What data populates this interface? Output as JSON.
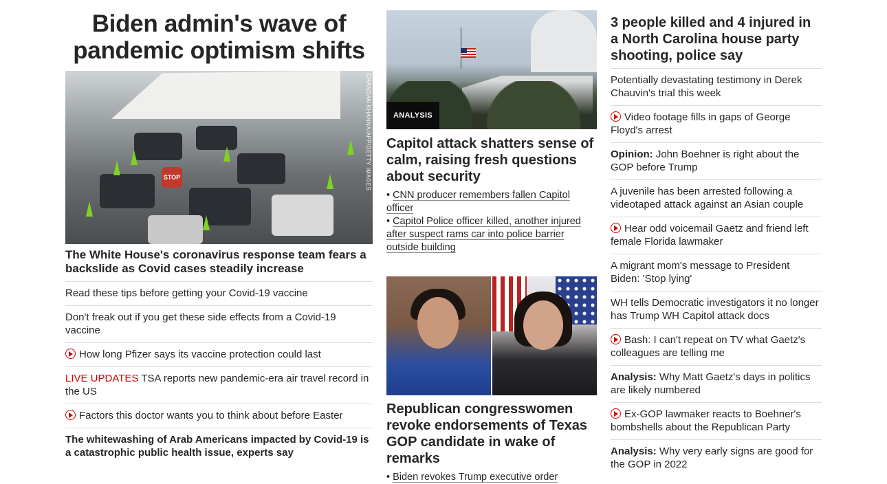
{
  "col1": {
    "section_title": "Biden admin's wave of pandemic optimism shifts",
    "photo_credit": "CHANDAN KHANNA/AFP/GETTY IMAGES",
    "photo_stop_sign": "STOP",
    "lead_headline": "The White House's coronavirus response team fears a backslide as Covid cases steadily increase",
    "items": [
      {
        "text": "Read these tips before getting your Covid-19 vaccine"
      },
      {
        "text": "Don't freak out if you get these side effects from a Covid-19 vaccine"
      },
      {
        "text": "How long Pfizer says its vaccine protection could last",
        "video": true
      },
      {
        "prefix": "LIVE UPDATES",
        "text": "TSA reports new pandemic-era air travel record in the US"
      },
      {
        "text": "Factors this doctor wants you to think about before Easter",
        "video": true
      },
      {
        "text": "The whitewashing of Arab Americans impacted by Covid-19 is a catastrophic public health issue, experts say",
        "bold": true
      }
    ]
  },
  "col2": {
    "capitol_badge": "ANALYSIS",
    "capitol_headline": "Capitol attack shatters sense of calm, raising fresh questions about security",
    "capitol_bullets": [
      "CNN producer remembers fallen Capitol officer",
      "Capitol Police officer killed, another injured after suspect rams car into police barrier outside building"
    ],
    "women_headline": "Republican congresswomen revoke endorsements of Texas GOP candidate in wake of remarks",
    "women_bullets": [
      "Biden revokes Trump executive order"
    ]
  },
  "col3": {
    "top_headline": "3 people killed and 4 injured in a North Carolina house party shooting, police say",
    "items": [
      {
        "text": "Potentially devastating testimony in Derek Chauvin's trial this week"
      },
      {
        "text": "Video footage fills in gaps of George Floyd's arrest",
        "video": true
      },
      {
        "kicker": "Opinion:",
        "text": "John Boehner is right about the GOP before Trump"
      },
      {
        "text": "A juvenile has been arrested following a videotaped attack against an Asian couple"
      },
      {
        "text": "Hear odd voicemail Gaetz and friend left female Florida lawmaker",
        "video": true
      },
      {
        "text": "A migrant mom's message to President Biden: 'Stop lying'"
      },
      {
        "text": "WH tells Democratic investigators it no longer has Trump WH Capitol attack docs"
      },
      {
        "text": "Bash: I can't repeat on TV what Gaetz's colleagues are telling me",
        "video": true
      },
      {
        "kicker": "Analysis:",
        "text": "Why Matt Gaetz's days in politics are likely numbered"
      },
      {
        "text": "Ex-GOP lawmaker reacts to Boehner's bombshells about the Republican Party",
        "video": true
      },
      {
        "kicker": "Analysis:",
        "text": "Why very early signs are good for the GOP in 2022"
      }
    ]
  },
  "colors": {
    "accent_red": "#cc0000",
    "text": "#262626",
    "divider": "#dcdcdc",
    "badge_bg": "#0c0c0c"
  }
}
